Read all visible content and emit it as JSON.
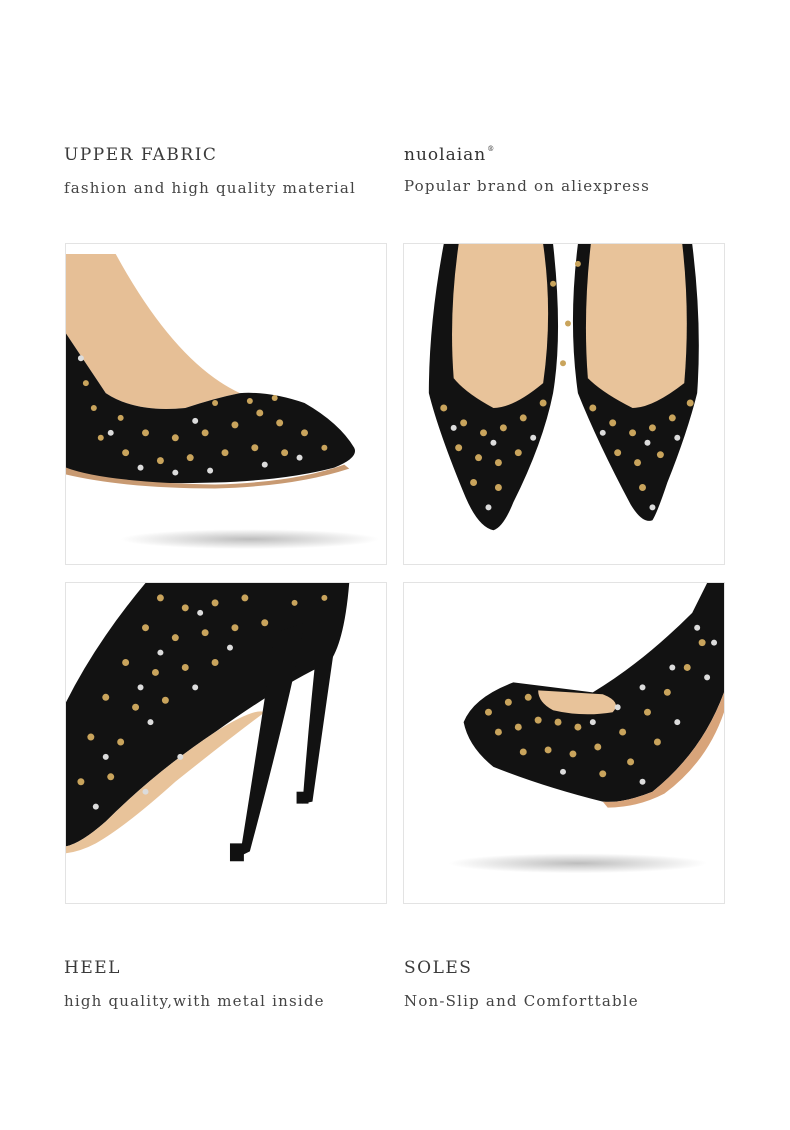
{
  "sections": {
    "upper_fabric": {
      "title": "UPPER FABRIC",
      "subtitle": "fashion and high quality material"
    },
    "brand": {
      "logo_text": "nuolaian",
      "logo_mark": "®",
      "subtitle": "Popular brand on aliexpress"
    },
    "heel": {
      "title": "HEEL",
      "subtitle": "high quality,with metal inside"
    },
    "soles": {
      "title": "SOLES",
      "subtitle": "Non-Slip and Comforttable"
    }
  },
  "images": [
    {
      "name": "side-view-shoe",
      "icon": "studded-pump-side"
    },
    {
      "name": "front-view-pair",
      "icon": "studded-pump-pair-front"
    },
    {
      "name": "heel-view-shoe",
      "icon": "studded-pump-heel"
    },
    {
      "name": "toe-view-shoe",
      "icon": "studded-pump-toe"
    }
  ],
  "colors": {
    "suede": "#111111",
    "lining": "#e8c39a",
    "stud_gold": "#c9a45c",
    "stud_crystal": "#d9d9d9",
    "shadow": "#cfcfcf"
  }
}
